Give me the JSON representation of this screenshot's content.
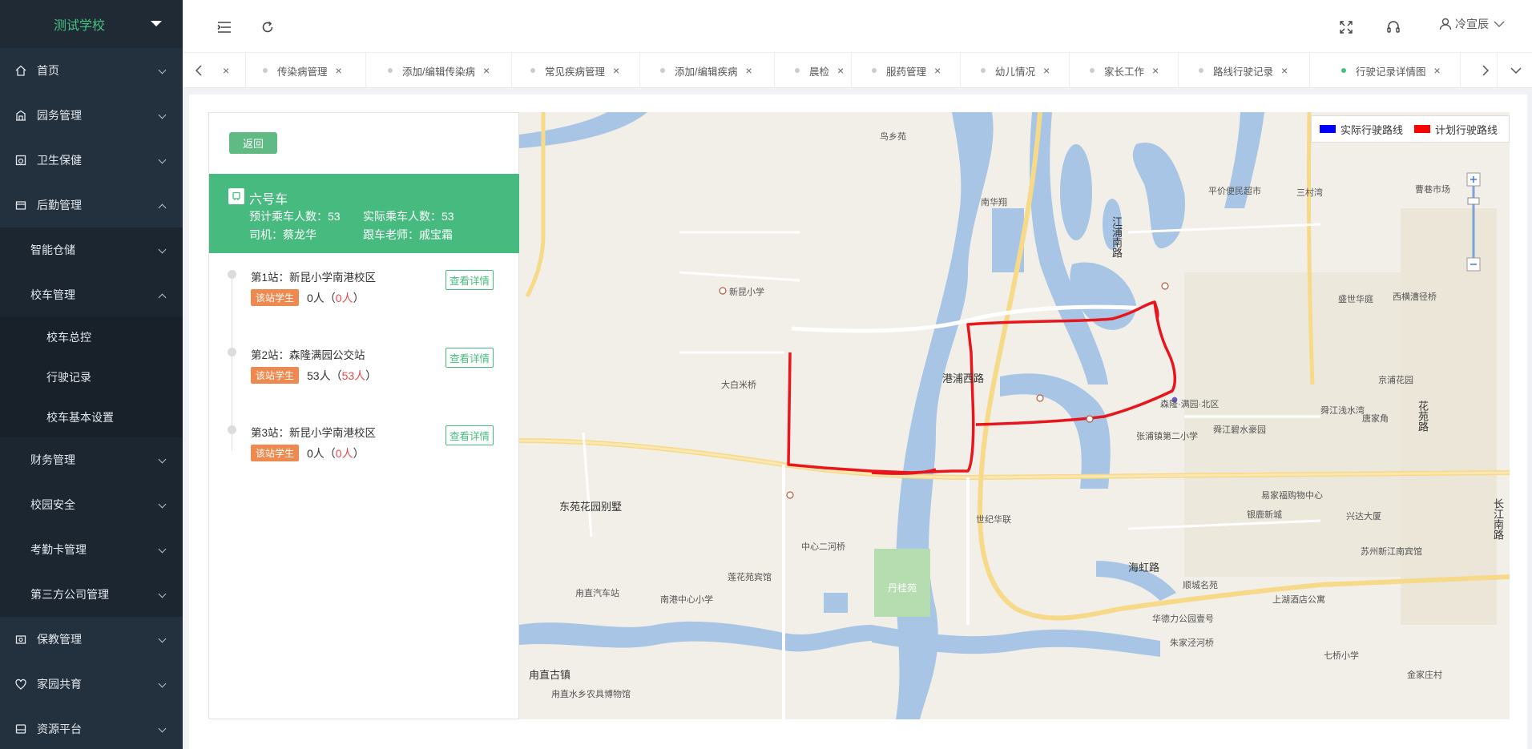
{
  "app": {
    "school": "测试学校"
  },
  "sidebar": {
    "items": [
      {
        "label": "首页",
        "icon": "home-icon"
      },
      {
        "label": "园务管理",
        "icon": "building-icon"
      },
      {
        "label": "卫生保健",
        "icon": "health-icon"
      },
      {
        "label": "后勤管理",
        "icon": "logistics-icon"
      }
    ],
    "logistics_sub": [
      {
        "label": "智能仓储"
      },
      {
        "label": "校车管理"
      }
    ],
    "bus_sub": [
      {
        "label": "校车总控"
      },
      {
        "label": "行驶记录"
      },
      {
        "label": "校车基本设置"
      }
    ],
    "logistics_sub2": [
      {
        "label": "财务管理"
      },
      {
        "label": "校园安全"
      },
      {
        "label": "考勤卡管理"
      },
      {
        "label": "第三方公司管理"
      }
    ],
    "bottom_items": [
      {
        "label": "保教管理",
        "icon": "teaching-icon"
      },
      {
        "label": "家园共育",
        "icon": "family-icon"
      },
      {
        "label": "资源平台",
        "icon": "resource-icon"
      }
    ]
  },
  "header": {
    "user": "冷宣辰"
  },
  "tabs": [
    {
      "label": "传染病管理"
    },
    {
      "label": "添加/编辑传染病"
    },
    {
      "label": "常见疾病管理"
    },
    {
      "label": "添加/编辑疾病"
    },
    {
      "label": "晨检"
    },
    {
      "label": "服药管理"
    },
    {
      "label": "幼儿情况"
    },
    {
      "label": "家长工作"
    },
    {
      "label": "路线行驶记录"
    },
    {
      "label": "行驶记录详情图",
      "active": true
    }
  ],
  "panel": {
    "back": "返回",
    "bus": {
      "name": "六号车",
      "expected": "预计乘车人数：53",
      "actual": "实际乘车人数：53",
      "driver": "司机：蔡龙华",
      "teacher": "跟车老师：戚宝霜"
    },
    "stops": [
      {
        "name": "第1站：新昆小学南港校区",
        "badge": "该站学生",
        "count": "0人（",
        "red": "0人",
        "close": "）",
        "detail": "查看详情"
      },
      {
        "name": "第2站：森隆满园公交站",
        "badge": "该站学生",
        "count": "53人（",
        "red": "53人",
        "close": "）",
        "detail": "查看详情"
      },
      {
        "name": "第3站：新昆小学南港校区",
        "badge": "该站学生",
        "count": "0人（",
        "red": "0人",
        "close": "）",
        "detail": "查看详情"
      }
    ]
  },
  "map": {
    "legend": {
      "actual": "实际行驶路线",
      "planned": "计划行驶路线",
      "actual_color": "#0000ff",
      "planned_color": "#ff0000"
    },
    "labels": [
      {
        "text": "港浦西路"
      },
      {
        "text": "海虹路"
      },
      {
        "text": "丹桂苑"
      },
      {
        "text": "东苑花园别墅"
      },
      {
        "text": "甪直古镇"
      },
      {
        "text": "江浦南路"
      },
      {
        "text": "长江南路"
      },
      {
        "text": "花苑路"
      },
      {
        "text": "鸟乡苑"
      },
      {
        "text": "南华翔"
      },
      {
        "text": "世纪华联"
      },
      {
        "text": "森隆·满园·北区"
      },
      {
        "text": "张浦镇第二小学"
      },
      {
        "text": "舜江碧水豪园"
      },
      {
        "text": "盛世华庭"
      },
      {
        "text": "新昆小学"
      },
      {
        "text": "大白米桥"
      },
      {
        "text": "中心二河桥"
      },
      {
        "text": "莲花苑宾馆"
      },
      {
        "text": "南港中心小学"
      },
      {
        "text": "甪直汽车站"
      },
      {
        "text": "甪直水乡农具博物馆"
      },
      {
        "text": "平价便民超市"
      },
      {
        "text": "三村湾"
      },
      {
        "text": "曹巷市场"
      },
      {
        "text": "西横漕径桥"
      },
      {
        "text": "京浦花园"
      },
      {
        "text": "舜江浅水湾"
      },
      {
        "text": "唐家角"
      },
      {
        "text": "易家福购物中心"
      },
      {
        "text": "银鹿新城"
      },
      {
        "text": "兴达大厦"
      },
      {
        "text": "苏州新江南宾馆"
      },
      {
        "text": "上湖酒店公寓"
      },
      {
        "text": "华德力公园壹号"
      },
      {
        "text": "顺城名苑"
      },
      {
        "text": "朱家泾河桥"
      },
      {
        "text": "七桥小学"
      },
      {
        "text": "金家庄村"
      }
    ]
  }
}
